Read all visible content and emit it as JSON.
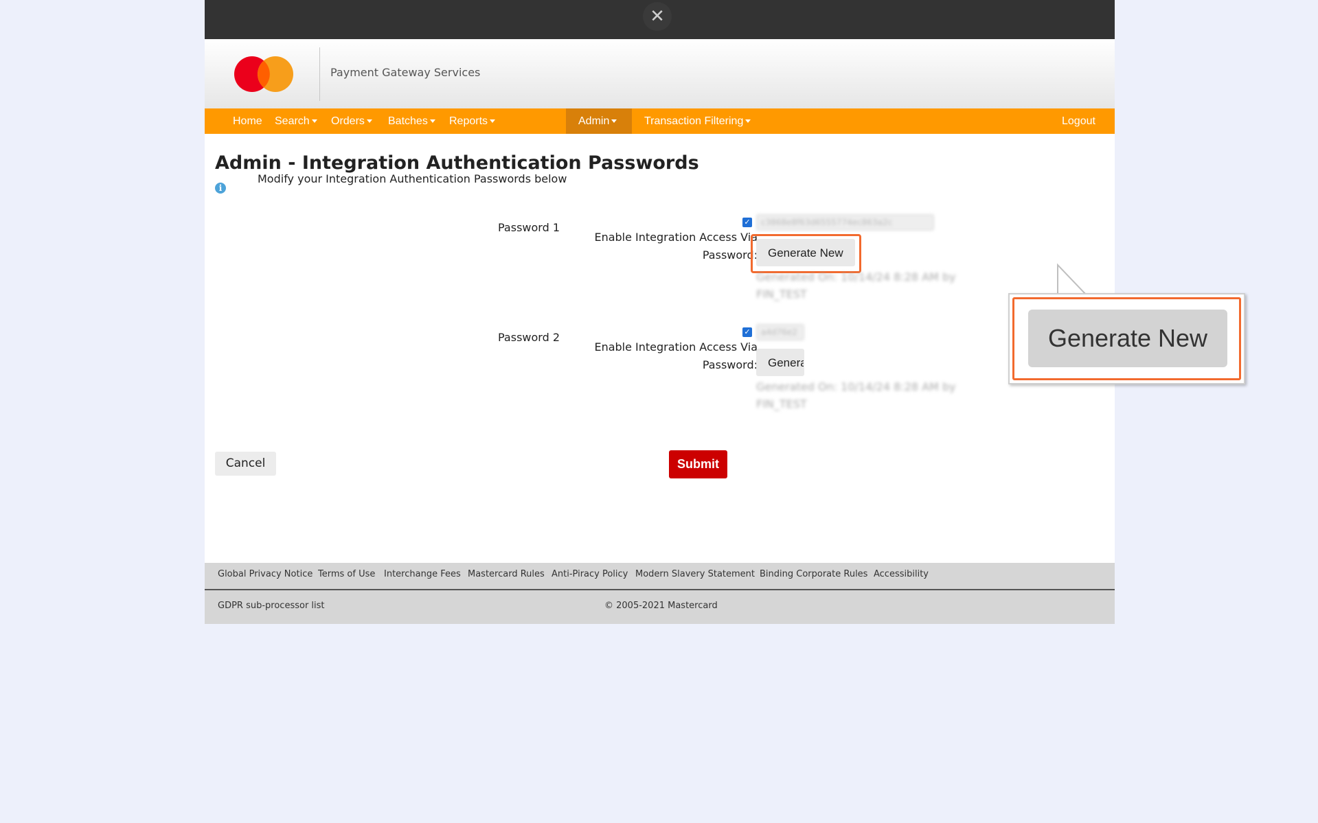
{
  "overlay": {
    "close_glyph": "✕"
  },
  "brand": {
    "name": "Payment Gateway Services",
    "logo": "mastercard-logo",
    "logo_colors": [
      "#eb001b",
      "#f79e1b",
      "#ff5f00"
    ]
  },
  "nav": {
    "items": [
      {
        "label": "Home",
        "dropdown": false
      },
      {
        "label": "Search",
        "dropdown": true
      },
      {
        "label": "Orders",
        "dropdown": true
      },
      {
        "label": "Batches",
        "dropdown": true
      },
      {
        "label": "Reports",
        "dropdown": true
      },
      {
        "label": "Admin",
        "dropdown": true,
        "active": true
      },
      {
        "label": "Transaction Filtering",
        "dropdown": true
      }
    ],
    "logout": "Logout",
    "color": "#ff9900",
    "active_color": "#d8800a"
  },
  "page": {
    "title": "Admin - Integration Authentication Passwords",
    "subtitle": "Modify your Integration Authentication Passwords below",
    "info_icon": "info-icon"
  },
  "passwords": [
    {
      "label": "Password 1",
      "enable_label_line1": "Enable Integration Access Via",
      "enable_label_line2": "Password:",
      "enabled": true,
      "value": "c3868e8f63d6555774ec863a2c",
      "generate_label": "Generate New",
      "generated_line1": "Generated On: 10/14/24 8:28 AM by",
      "generated_line2": "FIN_TEST"
    },
    {
      "label": "Password 2",
      "enable_label_line1": "Enable Integration Access Via",
      "enable_label_line2": "Password:",
      "enabled": true,
      "value": "a4d76e2",
      "generate_label": "Generate New",
      "generated_line1": "Generated On: 10/14/24 8:28 AM by",
      "generated_line2": "FIN_TEST"
    }
  ],
  "actions": {
    "cancel": "Cancel",
    "submit": "Submit",
    "submit_color": "#cc0000"
  },
  "callout": {
    "label": "Generate New",
    "highlight_color": "#f26a2e"
  },
  "footer": {
    "links": [
      "Global Privacy Notice",
      "Terms of Use",
      "Interchange Fees",
      "Mastercard Rules",
      "Anti-Piracy Policy",
      "Modern Slavery Statement",
      "Binding Corporate Rules",
      "Accessibility"
    ],
    "gdpr": "GDPR sub-processor list",
    "copyright": "© 2005-2021 Mastercard"
  }
}
